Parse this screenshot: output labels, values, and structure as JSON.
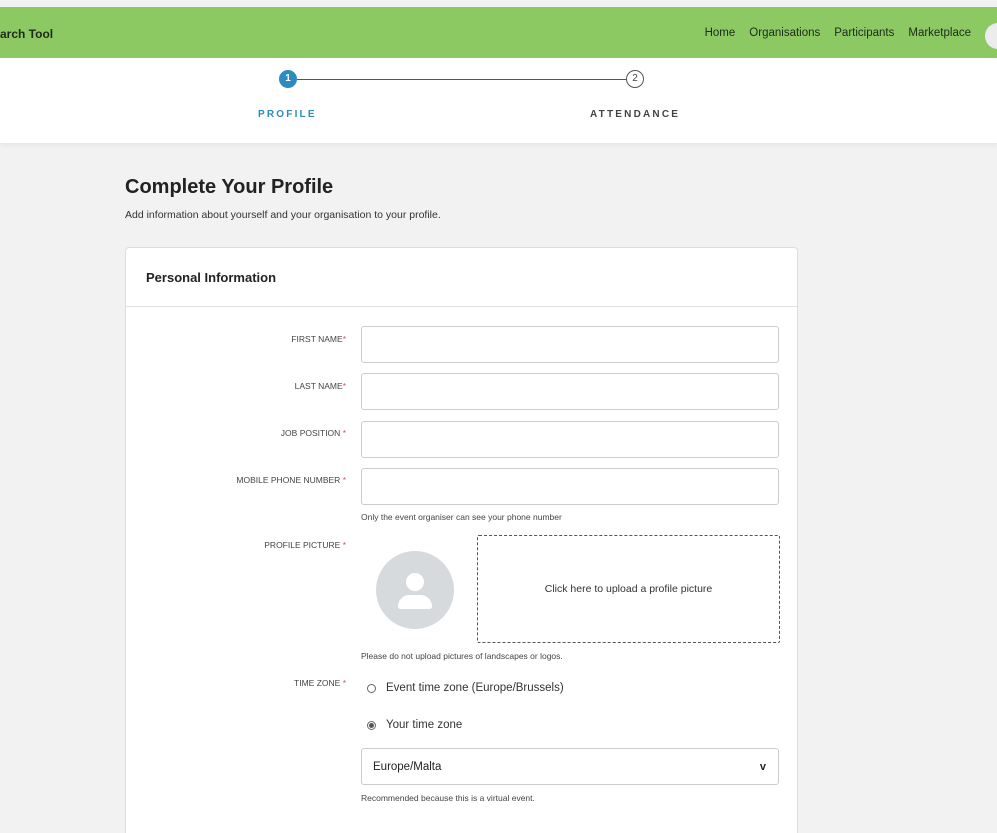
{
  "header": {
    "app_title": "arch Tool",
    "nav": [
      "Home",
      "Organisations",
      "Participants",
      "Marketplace"
    ]
  },
  "stepper": {
    "steps": [
      {
        "number": "1",
        "label": "PROFILE",
        "active": true
      },
      {
        "number": "2",
        "label": "ATTENDANCE",
        "active": false
      }
    ]
  },
  "page": {
    "title": "Complete Your Profile",
    "subtitle": "Add information about yourself and your organisation to your profile."
  },
  "card": {
    "title": "Personal Information",
    "fields": {
      "first_name": {
        "label": "FIRST NAME",
        "value": ""
      },
      "last_name": {
        "label": "LAST NAME",
        "value": ""
      },
      "job_position": {
        "label": "JOB POSITION",
        "value": ""
      },
      "mobile_phone": {
        "label": "MOBILE PHONE NUMBER",
        "value": "",
        "hint": "Only the event organiser can see your phone number"
      },
      "profile_picture": {
        "label": "PROFILE PICTURE",
        "upload_text": "Click here to upload a profile picture",
        "hint": "Please do not upload pictures of landscapes or logos."
      },
      "time_zone": {
        "label": "TIME ZONE",
        "options": [
          {
            "label": "Event time zone (Europe/Brussels)",
            "checked": false
          },
          {
            "label": "Your time zone",
            "checked": true
          }
        ],
        "selected": "Europe/Malta",
        "chevron": "v",
        "hint": "Recommended because this is a virtual event."
      }
    },
    "required_marker": "*"
  },
  "colors": {
    "topbar": "#8cc963",
    "accent": "#2e8bc0",
    "required": "#d9534f"
  }
}
